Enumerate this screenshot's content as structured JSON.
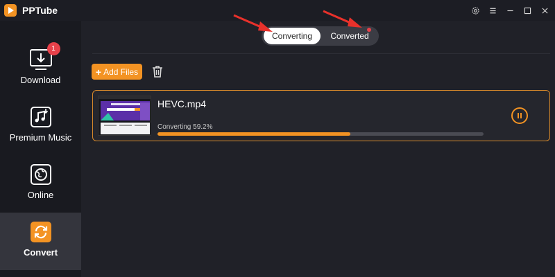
{
  "app": {
    "title": "PPTube"
  },
  "titlebar": {
    "icons": [
      "gear-icon",
      "menu-icon",
      "minimize-icon",
      "maximize-icon",
      "close-icon"
    ]
  },
  "sidebar": {
    "items": [
      {
        "label": "Download",
        "icon": "download-icon",
        "badge": "1",
        "active": false
      },
      {
        "label": "Premium Music",
        "icon": "music-icon",
        "active": false
      },
      {
        "label": "Online",
        "icon": "globe-icon",
        "active": false
      },
      {
        "label": "Convert",
        "icon": "convert-icon",
        "active": true
      }
    ]
  },
  "main": {
    "tabs": [
      {
        "label": "Converting",
        "active": true
      },
      {
        "label": "Converted",
        "active": false,
        "has_dot": true
      }
    ],
    "add_files_label": "Add Files",
    "add_files_plus": "+",
    "file": {
      "name": "HEVC.mp4",
      "status": "Converting 59.2%",
      "progress_percent": 59.2
    }
  },
  "colors": {
    "accent": "#f39323",
    "badge": "#e8414a",
    "annotation_arrow": "#e8312b"
  }
}
